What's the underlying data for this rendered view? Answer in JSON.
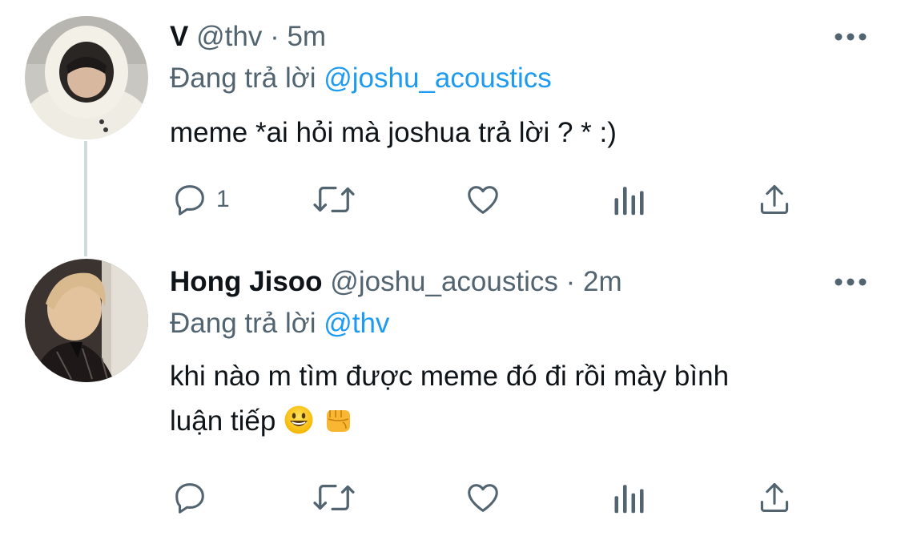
{
  "tweets": [
    {
      "display_name": "V",
      "handle": "@thv",
      "separator": "·",
      "time": "5m",
      "reply_prefix": "Đang trả lời",
      "reply_to": "@joshu_acoustics",
      "text": "meme *ai hỏi mà joshua trả lời ? * :)",
      "reply_count": "1",
      "retweet_count": "",
      "like_count": ""
    },
    {
      "display_name": "Hong Jisoo",
      "handle": "@joshu_acoustics",
      "separator": "·",
      "time": "2m",
      "reply_prefix": "Đang trả lời",
      "reply_to": "@thv",
      "text_line1": "khi nào m tìm được meme đó đi rồi mày bình",
      "text_line2": "luận tiếp",
      "emojis": [
        "grinning-face-emoji",
        "oncoming-fist-emoji"
      ],
      "reply_count": "",
      "retweet_count": "",
      "like_count": ""
    }
  ],
  "icons": {
    "more": "more-dots-icon",
    "reply": "reply-bubble-icon",
    "retweet": "retweet-icon",
    "like": "heart-icon",
    "analytics": "analytics-bars-icon",
    "share": "share-icon"
  },
  "colors": {
    "text": "#0f1419",
    "muted": "#536471",
    "mention": "#1d9bf0",
    "thread_line": "#cfd9de"
  }
}
